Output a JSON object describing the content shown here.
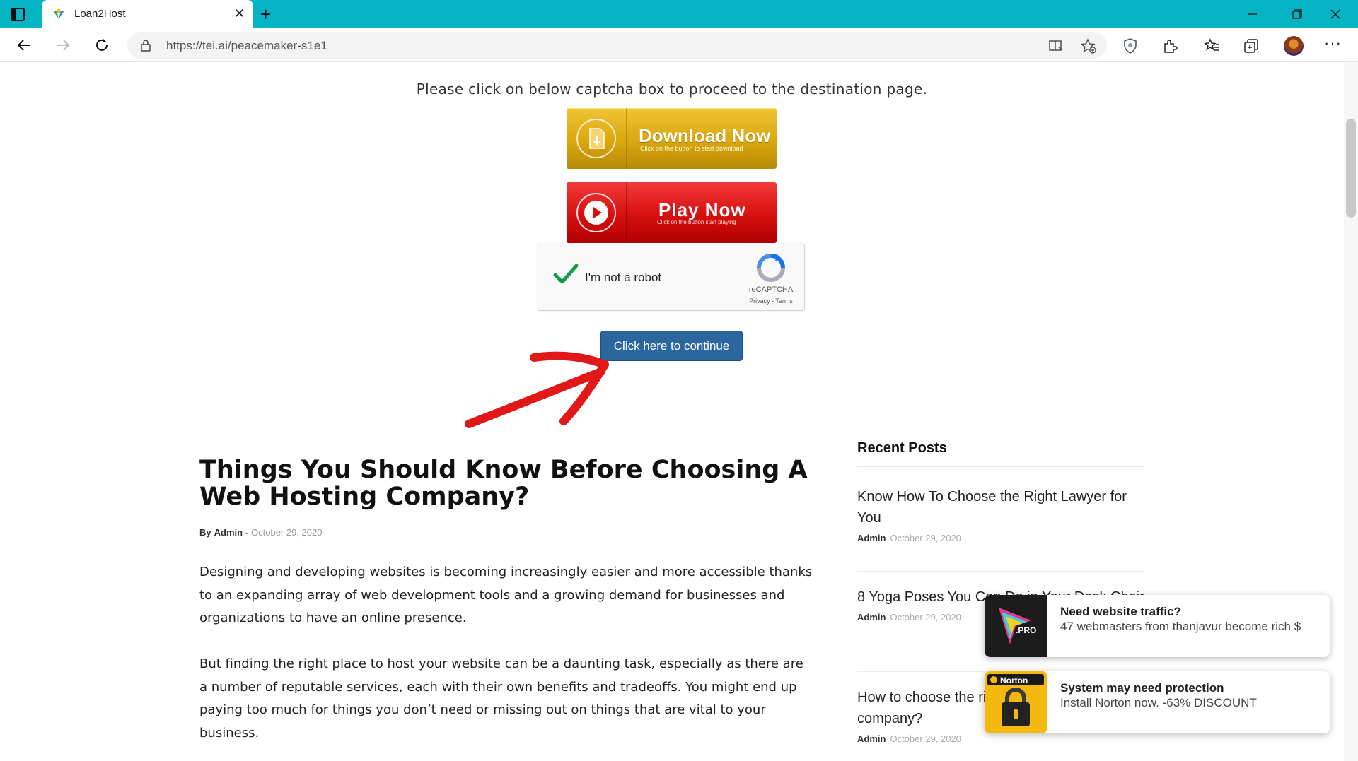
{
  "browser": {
    "tab_title": "Loan2Host",
    "url": "https://tei.ai/peacemaker-s1e1",
    "accent_color": "#04b4c4",
    "icons": [
      "tab-actions-icon",
      "favicon-icon",
      "close-tab-icon",
      "new-tab-icon",
      "minimize-icon",
      "maximize-icon",
      "close-window-icon",
      "back-icon",
      "forward-icon",
      "refresh-icon",
      "lock-icon",
      "reader-view-icon",
      "add-favorite-icon",
      "shield-icon",
      "extensions-icon",
      "favorites-icon",
      "collections-icon",
      "profile-avatar",
      "more-icon"
    ]
  },
  "page": {
    "captcha_note": "Please click on below captcha box to proceed to the destination page.",
    "download_button": {
      "title": "Download Now",
      "subtitle": "Click on the button to start download"
    },
    "play_button": {
      "title": "Play Now",
      "subtitle": "Click on the button start playing"
    },
    "recaptcha": {
      "label": "I'm not a robot",
      "brand": "reCAPTCHA",
      "terms": "Privacy - Terms",
      "checked": true
    },
    "continue_label": "Click here to continue"
  },
  "article": {
    "title": "Things You Should Know Before Choosing A Web Hosting Company?",
    "by": "By",
    "author": "Admin -",
    "date": "October 29, 2020",
    "paragraphs": [
      "Designing and developing websites is becoming increasingly easier and more accessible thanks to an expanding array of web development tools and a growing demand for businesses and organizations to have an online presence.",
      "But finding the right place to host your website can be a daunting task, especially as there are a number of reputable services, each with their own benefits and tradeoffs. You might end up paying too much for things you don’t need or missing out on things that are vital to your business."
    ]
  },
  "sidebar": {
    "heading": "Recent Posts",
    "posts": [
      {
        "title": "Know How To Choose the Right Lawyer for You",
        "author": "Admin",
        "date": "October 29, 2020"
      },
      {
        "title": "8 Yoga Poses You Can Do in Your Desk Chair",
        "author": "Admin",
        "date": "October 29, 2020"
      },
      {
        "title": "How to choose the right web hosting company?",
        "author": "Admin",
        "date": "October 29, 2020"
      }
    ]
  },
  "notifications": [
    {
      "title": "Need website traffic?",
      "body": "47 webmasters from thanjavur become rich $",
      "badge": ".PRO"
    },
    {
      "title": "System may need protection",
      "body": "Install Norton now. -63% DISCOUNT",
      "badge": "Norton"
    }
  ]
}
